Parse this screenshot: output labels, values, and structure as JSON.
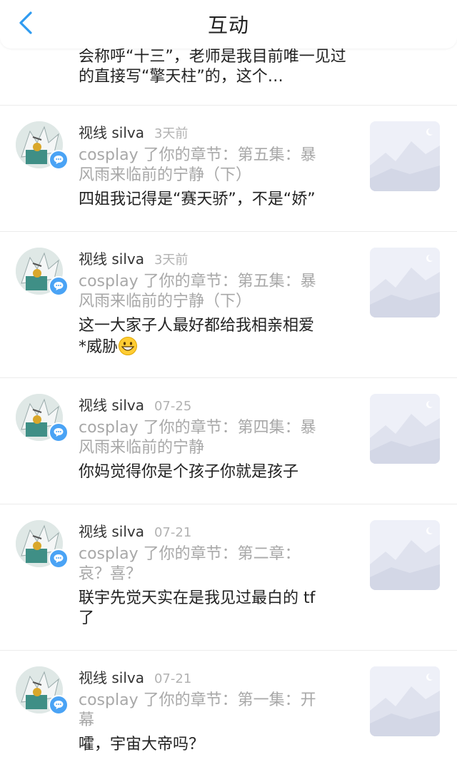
{
  "header": {
    "title": "互动"
  },
  "partial_item": {
    "comment": "会称呼“十三”，老师是我目前唯一见过的直接写“擎天柱”的，这个…"
  },
  "items": [
    {
      "name": "视线 silva",
      "time": "3天前",
      "target_line1": "cosplay 了你的章节：第五集：暴",
      "target_line2": "风雨来临前的宁静（下）",
      "comment_line1": "四姐我记得是“赛天骄”，不是“娇”",
      "comment_line2": ""
    },
    {
      "name": "视线 silva",
      "time": "3天前",
      "target_line1": "cosplay 了你的章节：第五集：暴",
      "target_line2": "风雨来临前的宁静（下）",
      "comment_line1": "这一大家子人最好都给我相亲相爱",
      "comment_line2": "*威胁"
    },
    {
      "name": "视线 silva",
      "time": "07-25",
      "target_line1": "cosplay 了你的章节：第四集：暴",
      "target_line2": "风雨来临前的宁静",
      "comment_line1": "你妈觉得你是个孩子你就是孩子",
      "comment_line2": ""
    },
    {
      "name": "视线 silva",
      "time": "07-21",
      "target_line1": "cosplay 了你的章节：第二章：",
      "target_line2": "哀？喜？",
      "comment_line1": "联宇先觉天实在是我见过最白的 tf",
      "comment_line2": "了"
    },
    {
      "name": "视线 silva",
      "time": "07-21",
      "target_line1": "cosplay 了你的章节：第一集：开",
      "target_line2": "幕",
      "comment_line1": "嚯，宇宙大帝吗？",
      "comment_line2": ""
    }
  ],
  "colors": {
    "accent": "#2f9bf0",
    "badge": "#4aa3f5",
    "muted": "#a8a8a8",
    "text": "#222222",
    "divider": "#ececec"
  },
  "icons": {
    "back": "chevron-left-icon",
    "badge": "comment-bubble-icon",
    "emoji": "grinning-face-icon",
    "thumb": "image-placeholder-icon"
  }
}
